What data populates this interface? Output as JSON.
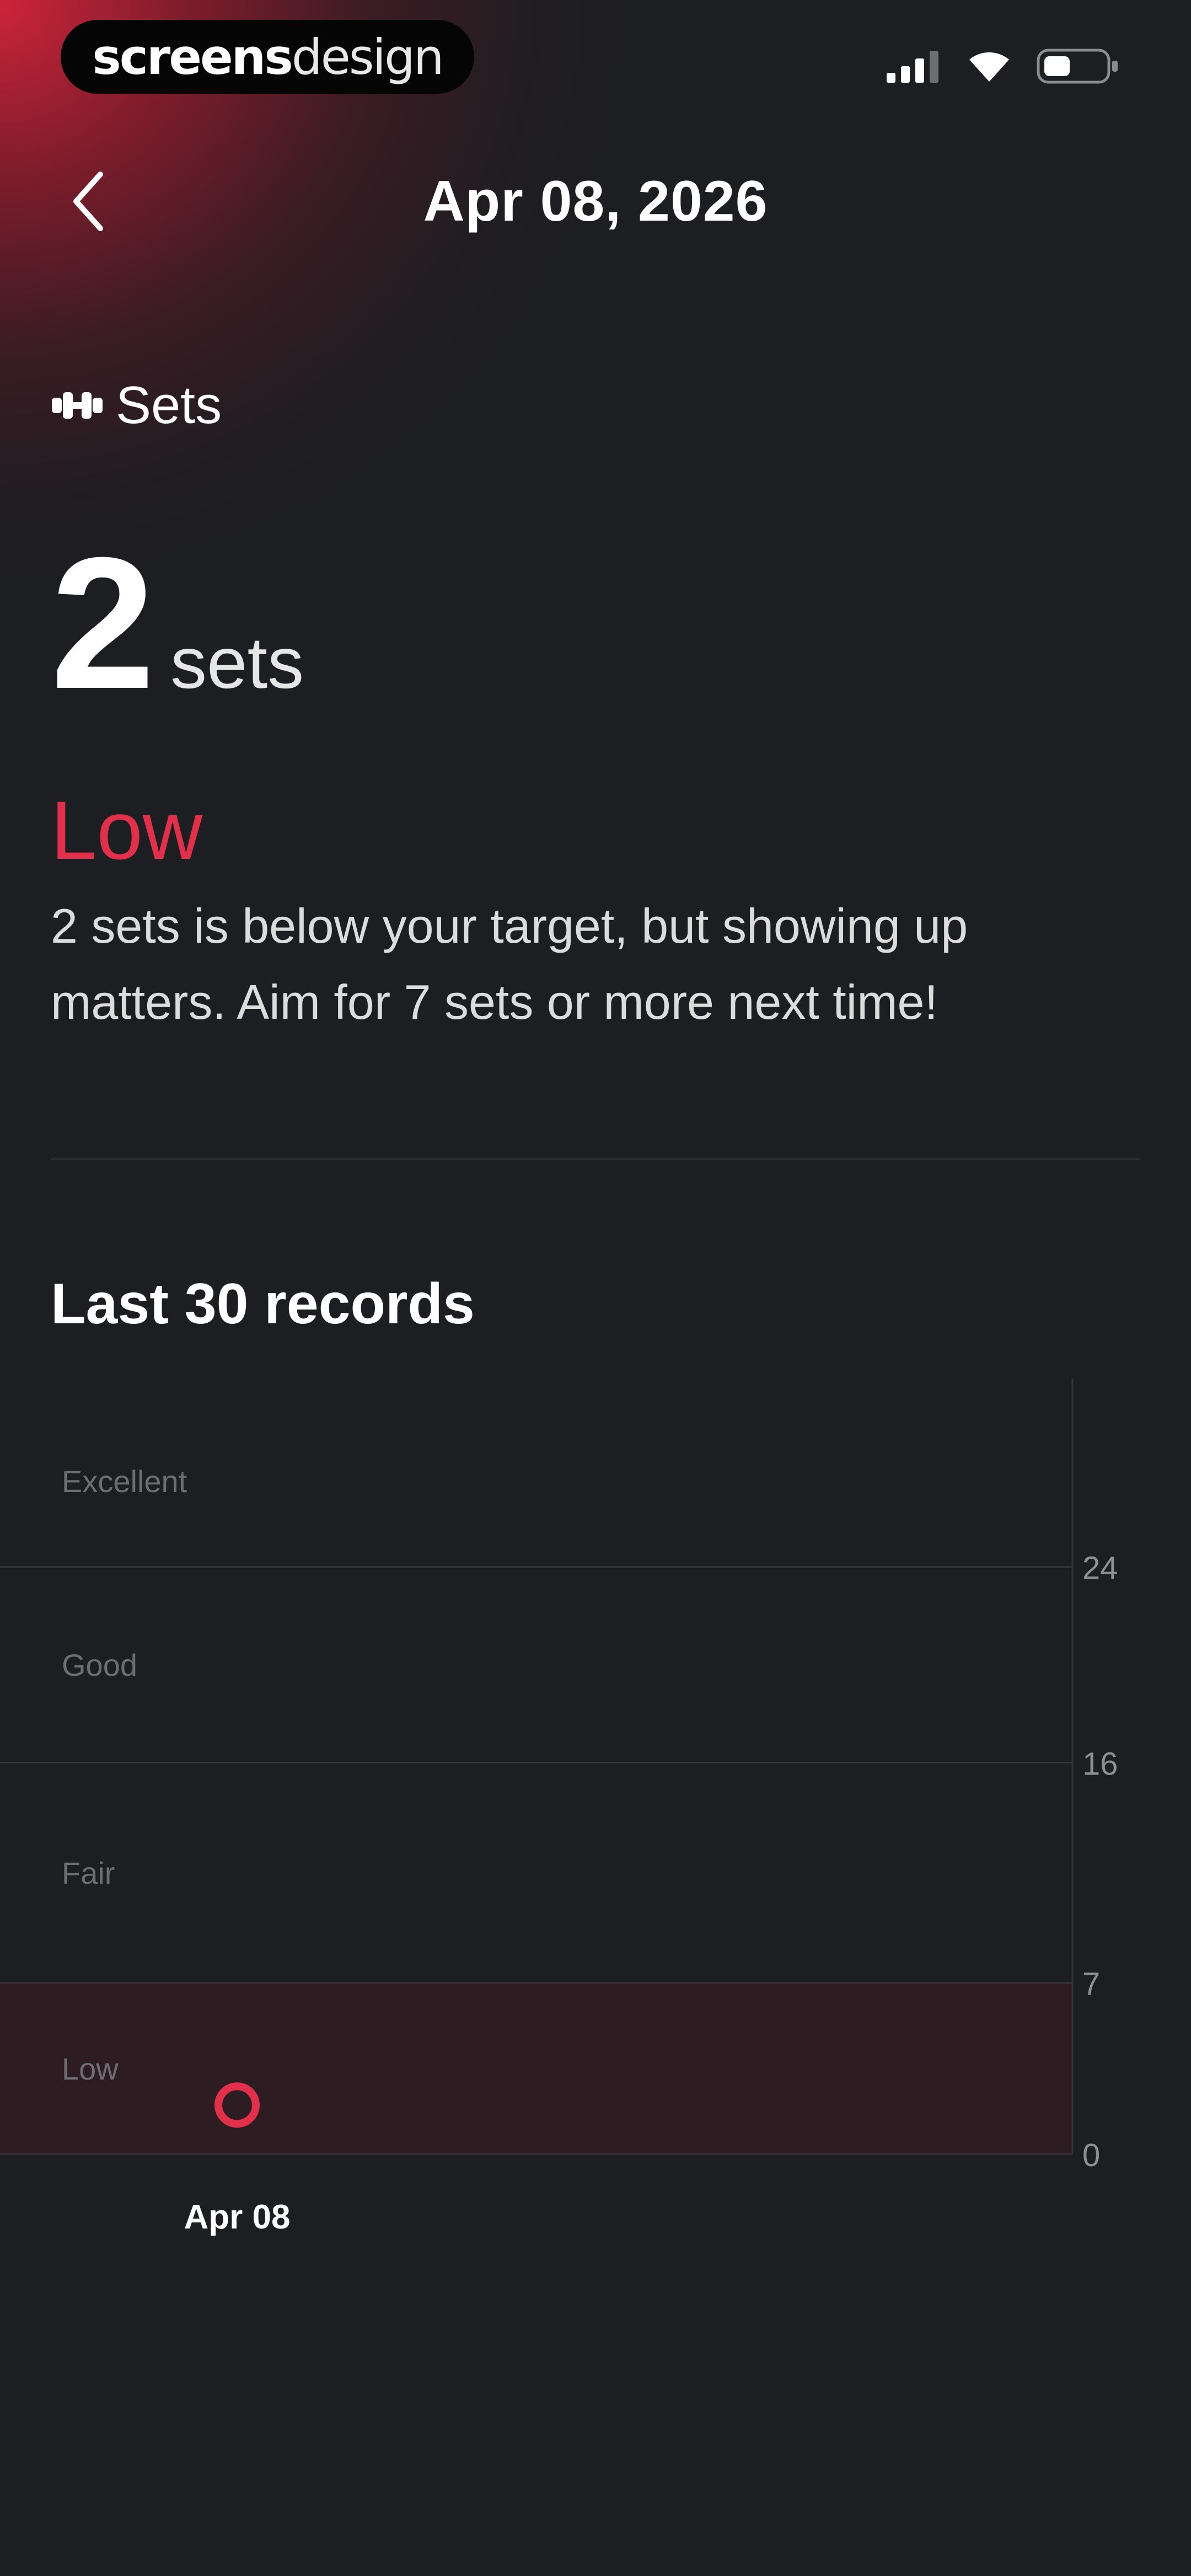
{
  "status_bar": {
    "brand_bold": "screens",
    "brand_light": "design"
  },
  "header": {
    "title": "Apr 08, 2026"
  },
  "metric": {
    "label": "Sets",
    "value": "2",
    "unit": "sets",
    "rating": "Low",
    "description": "2 sets is below your target, but showing up matters. Aim for 7 sets or more next time!"
  },
  "history": {
    "title": "Last 30 records"
  },
  "colors": {
    "accent": "#e3304a",
    "low_band": "#2d1c22",
    "background": "#1c1e22"
  },
  "chart_data": {
    "type": "scatter",
    "x": [
      "Apr 08"
    ],
    "y": [
      2
    ],
    "ylim": [
      0,
      31
    ],
    "yticks": [
      0,
      7,
      16,
      24
    ],
    "bands": [
      {
        "label": "Excellent",
        "from": 24,
        "to": 31
      },
      {
        "label": "Good",
        "from": 16,
        "to": 24
      },
      {
        "label": "Fair",
        "from": 7,
        "to": 16
      },
      {
        "label": "Low",
        "from": 0,
        "to": 7
      }
    ],
    "highlight_band": "Low",
    "grid": true
  }
}
